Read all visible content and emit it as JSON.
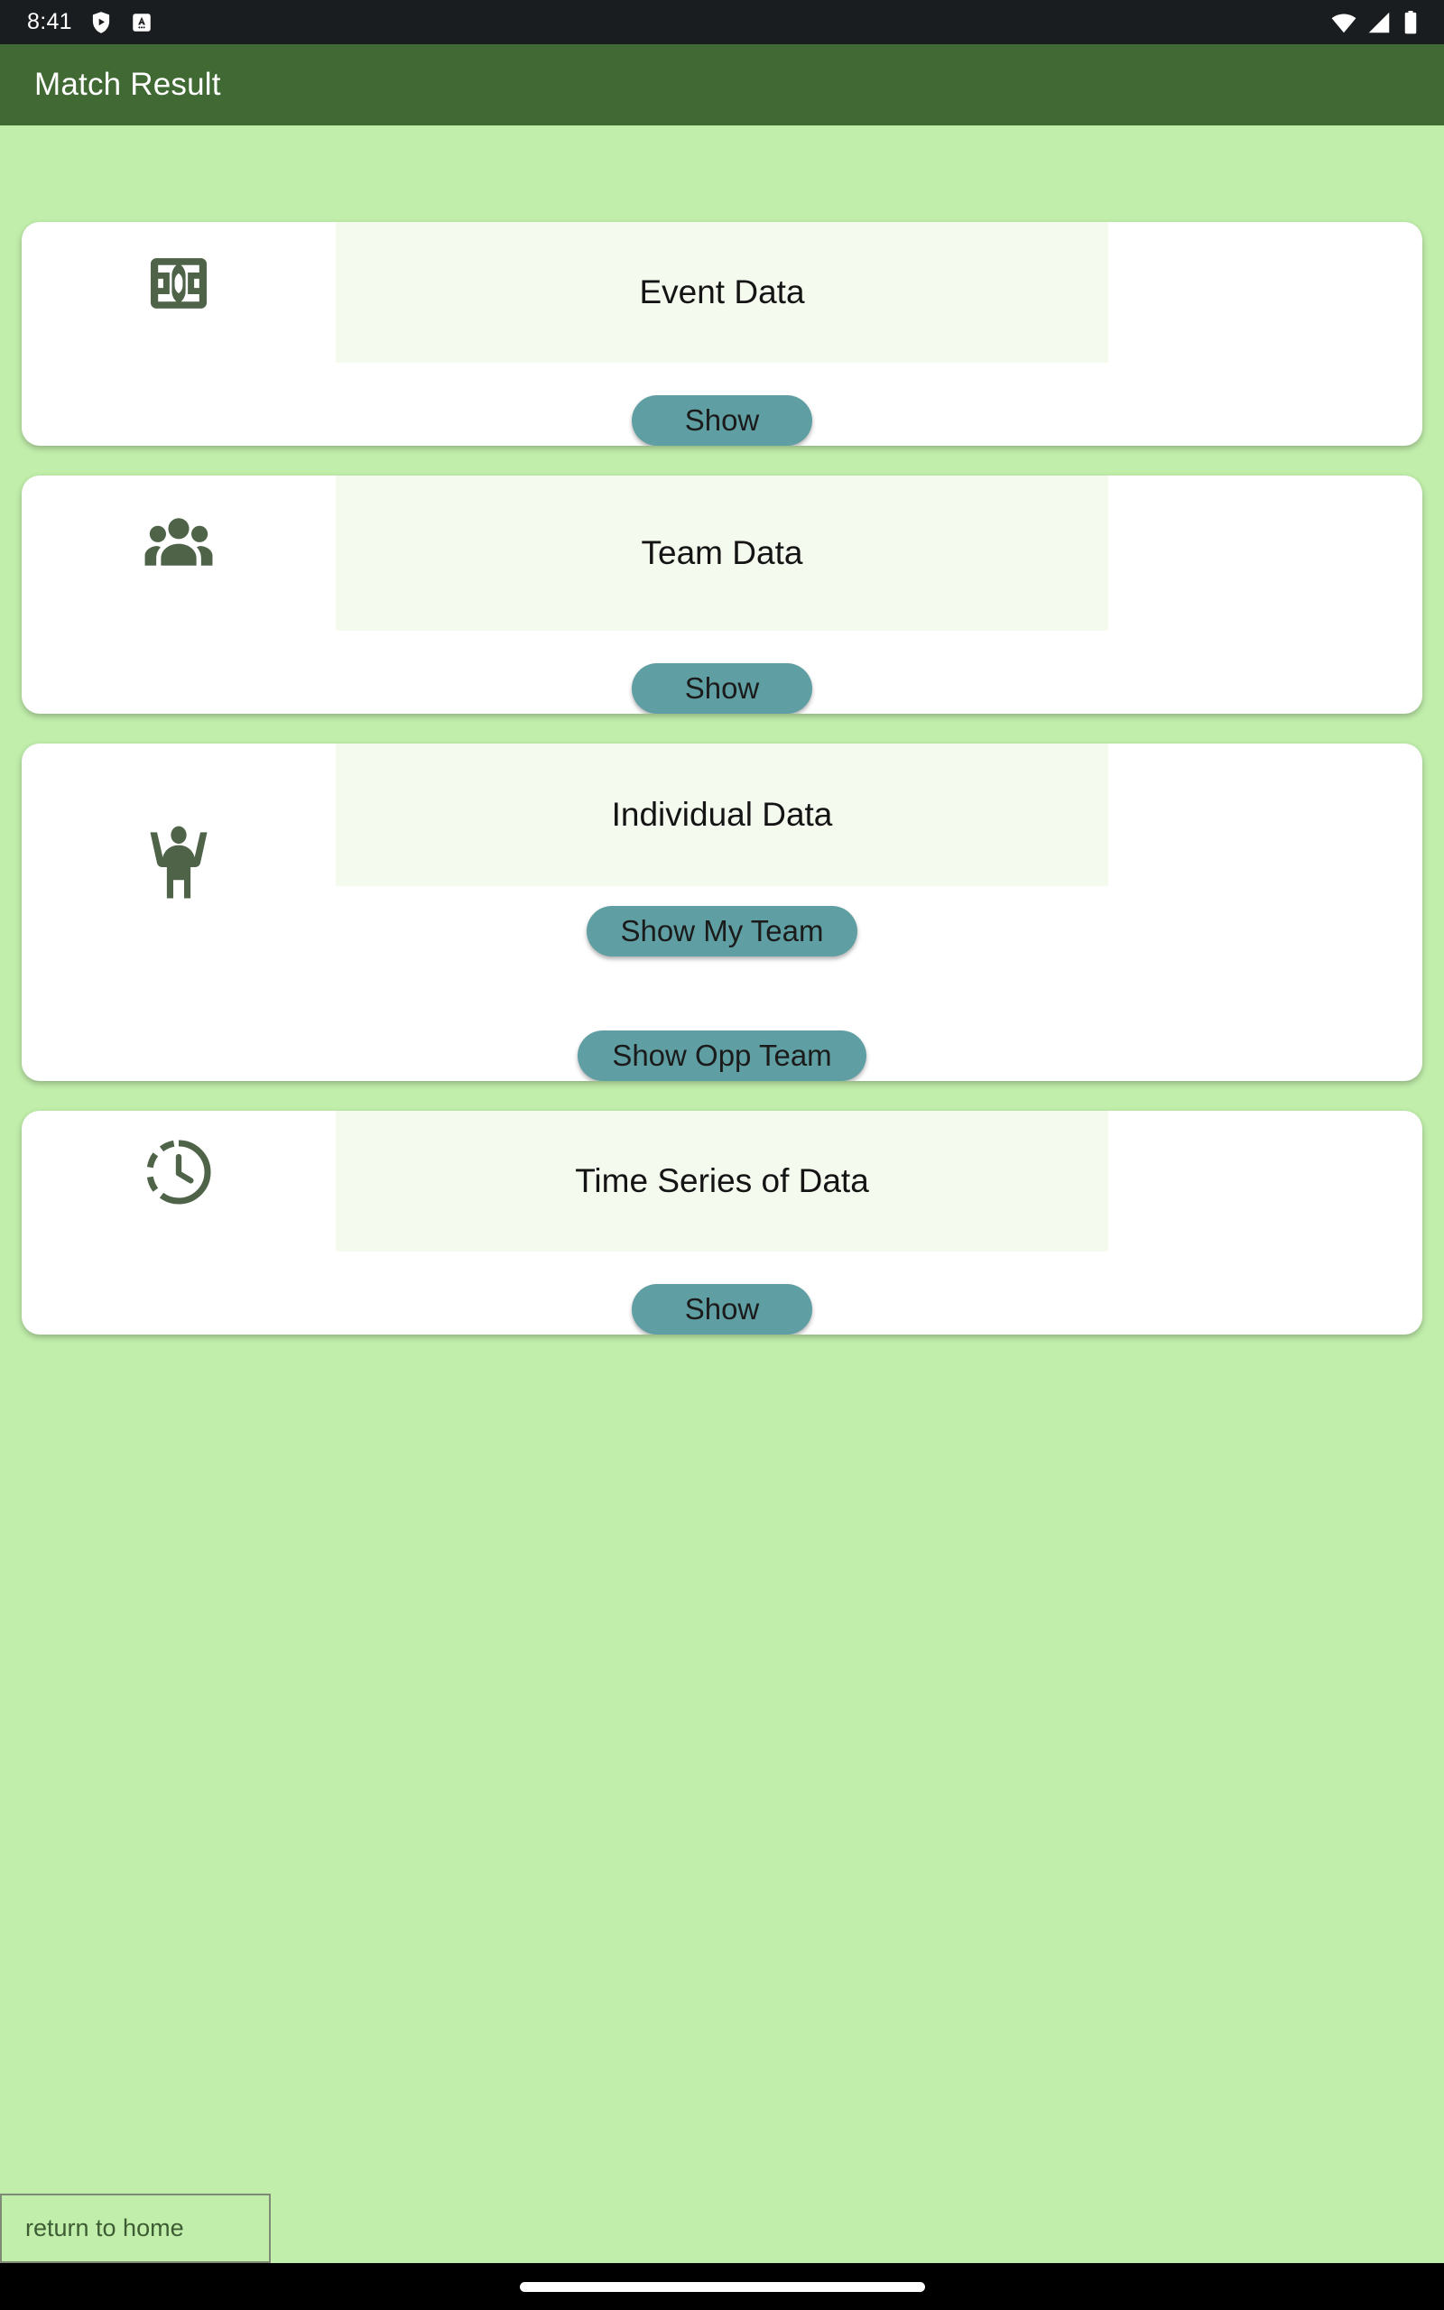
{
  "status_bar": {
    "time": "8:41",
    "left_icons": [
      "play-protect-shield-icon",
      "app-notification-a-icon"
    ],
    "right_icons": [
      "wifi-icon",
      "cellular-signal-icon",
      "battery-icon"
    ]
  },
  "app_bar": {
    "title": "Match Result"
  },
  "theme": {
    "app_bar_color": "#406934",
    "background_color": "#c1eeab",
    "card_color": "#ffffff",
    "label_band_color": "#f5faef",
    "button_color": "#5f9fa3",
    "icon_color": "#4e6348",
    "title_text_color": "#ffffff"
  },
  "cards": [
    {
      "id": "event-data",
      "icon": "soccer-pitch-icon",
      "label": "Event Data",
      "buttons": [
        {
          "id": "show",
          "label": "Show"
        }
      ]
    },
    {
      "id": "team-data",
      "icon": "people-group-icon",
      "label": "Team Data",
      "buttons": [
        {
          "id": "show",
          "label": "Show"
        }
      ]
    },
    {
      "id": "individual-data",
      "icon": "person-arms-raised-icon",
      "label": "Individual Data",
      "buttons": [
        {
          "id": "show-my-team",
          "label": "Show My Team"
        },
        {
          "id": "show-opp-team",
          "label": "Show Opp Team"
        }
      ]
    },
    {
      "id": "time-series-of-data",
      "icon": "clock-history-icon",
      "label": "Time Series of Data",
      "buttons": [
        {
          "id": "show",
          "label": "Show"
        }
      ]
    }
  ],
  "bottom": {
    "return_home_label": "return to home"
  }
}
